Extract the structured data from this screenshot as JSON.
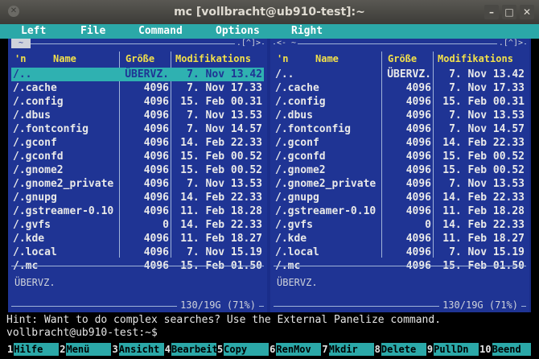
{
  "window": {
    "title": "mc [vollbracht@ub910-test]:~"
  },
  "menubar": [
    "Left",
    "File",
    "Command",
    "Options",
    "Right"
  ],
  "panels": {
    "left": {
      "corner_left": "~",
      "corner_right": ".[^]>",
      "headers": {
        "n": "'n",
        "name": "Name",
        "size": "Größe",
        "mod": "Modifikations"
      },
      "rows": [
        {
          "name": "/..",
          "size": "ÜBERVZ.",
          "date": "7. Nov 13.42",
          "selected": true
        },
        {
          "name": "/.cache",
          "size": "4096",
          "date": "7. Nov 17.33"
        },
        {
          "name": "/.config",
          "size": "4096",
          "date": "15. Feb 00.31"
        },
        {
          "name": "/.dbus",
          "size": "4096",
          "date": "7. Nov 13.53"
        },
        {
          "name": "/.fontconfig",
          "size": "4096",
          "date": "7. Nov 14.57"
        },
        {
          "name": "/.gconf",
          "size": "4096",
          "date": "14. Feb 22.33"
        },
        {
          "name": "/.gconfd",
          "size": "4096",
          "date": "15. Feb 00.52"
        },
        {
          "name": "/.gnome2",
          "size": "4096",
          "date": "15. Feb 00.52"
        },
        {
          "name": "/.gnome2_private",
          "size": "4096",
          "date": "7. Nov 13.53"
        },
        {
          "name": "/.gnupg",
          "size": "4096",
          "date": "14. Feb 22.33"
        },
        {
          "name": "/.gstreamer-0.10",
          "size": "4096",
          "date": "11. Feb 18.28"
        },
        {
          "name": "/.gvfs",
          "size": "0",
          "date": "14. Feb 22.33"
        },
        {
          "name": "/.kde",
          "size": "4096",
          "date": "11. Feb 18.27"
        },
        {
          "name": "/.local",
          "size": "4096",
          "date": "7. Nov 15.19"
        },
        {
          "name": "/.mc",
          "size": "4096",
          "date": "15. Feb 01.50"
        }
      ],
      "mini_status": "ÜBERVZ.",
      "usage": "130/19G (71%)"
    },
    "right": {
      "corner_left": "<- ~",
      "corner_right": ".[^]>",
      "headers": {
        "n": "'n",
        "name": "Name",
        "size": "Größe",
        "mod": "Modifikations"
      },
      "rows": [
        {
          "name": "/..",
          "size": "ÜBERVZ.",
          "date": "7. Nov 13.42"
        },
        {
          "name": "/.cache",
          "size": "4096",
          "date": "7. Nov 17.33"
        },
        {
          "name": "/.config",
          "size": "4096",
          "date": "15. Feb 00.31"
        },
        {
          "name": "/.dbus",
          "size": "4096",
          "date": "7. Nov 13.53"
        },
        {
          "name": "/.fontconfig",
          "size": "4096",
          "date": "7. Nov 14.57"
        },
        {
          "name": "/.gconf",
          "size": "4096",
          "date": "14. Feb 22.33"
        },
        {
          "name": "/.gconfd",
          "size": "4096",
          "date": "15. Feb 00.52"
        },
        {
          "name": "/.gnome2",
          "size": "4096",
          "date": "15. Feb 00.52"
        },
        {
          "name": "/.gnome2_private",
          "size": "4096",
          "date": "7. Nov 13.53"
        },
        {
          "name": "/.gnupg",
          "size": "4096",
          "date": "14. Feb 22.33"
        },
        {
          "name": "/.gstreamer-0.10",
          "size": "4096",
          "date": "11. Feb 18.28"
        },
        {
          "name": "/.gvfs",
          "size": "0",
          "date": "14. Feb 22.33"
        },
        {
          "name": "/.kde",
          "size": "4096",
          "date": "11. Feb 18.27"
        },
        {
          "name": "/.local",
          "size": "4096",
          "date": "7. Nov 15.19"
        },
        {
          "name": "/.mc",
          "size": "4096",
          "date": "15. Feb 01.50"
        }
      ],
      "mini_status": "ÜBERVZ.",
      "usage": "130/19G (71%)"
    }
  },
  "hint": "Hint: Want to do complex searches? Use the External Panelize command.",
  "prompt": "vollbracht@ub910-test:~$",
  "fkeys": [
    {
      "num": "1",
      "label": "Hilfe"
    },
    {
      "num": "2",
      "label": "Menü"
    },
    {
      "num": "3",
      "label": "Ansicht"
    },
    {
      "num": "4",
      "label": "Bearbeiten"
    },
    {
      "num": "5",
      "label": "Copy"
    },
    {
      "num": "6",
      "label": "RenMov"
    },
    {
      "num": "7",
      "label": "Mkdir"
    },
    {
      "num": "8",
      "label": "Delete"
    },
    {
      "num": "9",
      "label": "PullDn"
    },
    {
      "num": "10",
      "label": "Beend"
    }
  ],
  "colors": {
    "panel_bg": "#1f3494",
    "menu_bg": "#2ba8a8",
    "header_fg": "#f2e04a",
    "selection": "#2fb1b1"
  }
}
